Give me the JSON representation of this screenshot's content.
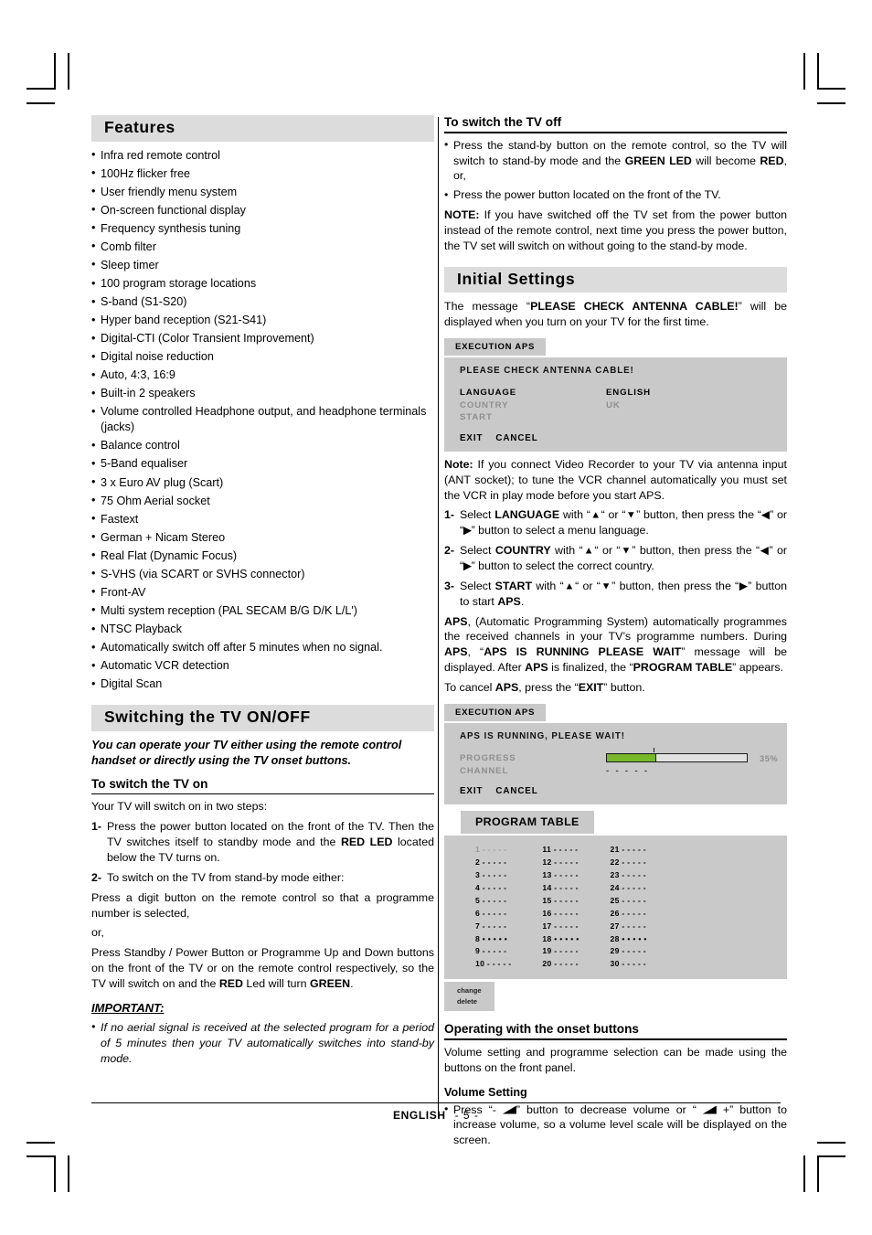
{
  "footer": {
    "language": "ENGLISH",
    "page": "- 5 -"
  },
  "left": {
    "features_header": "Features",
    "features": [
      "Infra red remote control",
      "100Hz flicker free",
      "User friendly menu system",
      "On-screen functional display",
      "Frequency synthesis tuning",
      "Comb filter",
      "Sleep timer",
      "100 program storage locations",
      "S-band (S1-S20)",
      "Hyper band reception (S21-S41)",
      "Digital-CTI (Color Transient Improvement)",
      "Digital noise reduction",
      "Auto, 4:3, 16:9",
      "Built-in 2 speakers",
      "Volume controlled Headphone output, and headphone terminals (jacks)",
      "Balance control",
      "5-Band equaliser",
      "3 x Euro AV plug (Scart)",
      "75 Ohm Aerial socket",
      "Fastext",
      "German + Nicam Stereo",
      "Real Flat (Dynamic Focus)",
      "S-VHS (via SCART or SVHS connector)",
      "Front-AV",
      "Multi system reception (PAL SECAM B/G D/K L/L')",
      "NTSC Playback",
      "Automatically switch off after 5 minutes when no signal.",
      "Automatic VCR detection",
      "Digital Scan"
    ],
    "switching_header": "Switching the TV ON/OFF",
    "switching_intro": "You can operate your TV either using the remote control handset or directly using the TV onset buttons.",
    "tv_on_header": "To switch the TV on",
    "tv_on_intro": "Your TV will switch on in two steps:",
    "step1_num": "1-",
    "step1_a": "Press the power button located on the front of the TV. Then the TV switches itself to standby mode and the ",
    "step1_bold": "RED LED",
    "step1_b": " located below the TV turns on.",
    "step2_num": "2-",
    "step2": "To switch on the TV from stand-by mode either:",
    "para_digit": "Press a digit button on the remote control so that a programme number is selected,",
    "or_text": "or,",
    "para_standby_a": "Press Standby / Power Button or Programme Up and Down buttons on the front of the TV or on the remote control respectively, so the TV will switch on and the ",
    "para_standby_red": "RED",
    "para_standby_b": " Led will turn ",
    "para_standby_green": "GREEN",
    "para_standby_c": ".",
    "important_header": "IMPORTANT:",
    "important_text": "If no aerial signal is received at the selected program for a period of 5 minutes then your TV automatically switches into stand-by mode."
  },
  "right": {
    "tv_off_header": "To switch the TV off",
    "tv_off_b1_a": "Press the stand-by button on the remote control, so the TV will switch to stand-by mode and the ",
    "tv_off_b1_green": "GREEN LED",
    "tv_off_b1_b": " will become ",
    "tv_off_b1_red": "RED",
    "tv_off_b1_c": ",    or,",
    "tv_off_b2": "Press the power button located on the front of the TV.",
    "note_label": "NOTE:",
    "note_text": " If you have switched off the TV set from the power button instead of the remote control, next time you press the power button, the TV set will switch on without going to the stand-by mode.",
    "initial_header": "Initial Settings",
    "initial_intro_a": "The message “",
    "initial_intro_bold": "PLEASE CHECK ANTENNA CABLE!",
    "initial_intro_b": "” will be displayed when you turn on your TV for the first time.",
    "osd1": {
      "tab": "EXECUTION APS",
      "message": "PLEASE  CHECK  ANTENNA  CABLE!",
      "rows": [
        {
          "label": "LANGUAGE",
          "value": "ENGLISH",
          "dim": false
        },
        {
          "label": "COUNTRY",
          "value": "UK",
          "dim": true
        },
        {
          "label": "START",
          "value": "",
          "dim": true
        }
      ],
      "exit": "EXIT",
      "cancel": "CANCEL"
    },
    "note2_label": "Note:",
    "note2_text": " If you connect Video Recorder to your TV via antenna input (ANT socket); to tune the VCR channel automatically you must set the VCR in play mode before you start APS.",
    "step1_num": "1-",
    "step1_a": "Select ",
    "step1_bold": "LANGUAGE",
    "step1_b": " with “",
    "step1_up": "▲",
    "step1_c": "“ or “",
    "step1_down": "▼",
    "step1_d": "” button, then press the “",
    "step1_left": "◀",
    "step1_e": "” or “",
    "step1_right": "▶",
    "step1_f": "” button to select a menu language.",
    "step2_num": "2-",
    "step2_bold": "COUNTRY",
    "step2_f": "” button to select the correct country.",
    "step3_num": "3-",
    "step3_bold": "START",
    "step3_d": "” button, then press the “",
    "step3_f": "” button to start ",
    "step3_aps": "APS",
    "step3_end": ".",
    "aps_para_a": "APS",
    "aps_para_b": ", (Automatic Programming System) automatically programmes the received channels in your TV’s programme numbers. During ",
    "aps_para_c": "APS",
    "aps_para_d": ", “",
    "aps_para_e": "APS IS RUNNING PLEASE WAIT",
    "aps_para_f": "” message will be displayed. After ",
    "aps_para_g": "APS",
    "aps_para_h": " is finalized, the “",
    "aps_para_i": "PROGRAM TABLE",
    "aps_para_j": "” appears.",
    "cancel_para_a": "To cancel ",
    "cancel_para_b": "APS",
    "cancel_para_c": ", press the “",
    "cancel_para_d": "EXIT",
    "cancel_para_e": "” button.",
    "osd2": {
      "tab": "EXECUTION APS",
      "message": "APS  IS  RUNNING,  PLEASE  WAIT!",
      "progress_label": "PROGRESS",
      "progress_percent": "35%",
      "progress_value": 35,
      "channel_label": "CHANNEL",
      "channel_value": "- - - - -",
      "exit": "EXIT",
      "cancel": "CANCEL"
    },
    "program_table": {
      "title": "PROGRAM TABLE",
      "columns": [
        [
          "1 - - - - -",
          "2 - - - - -",
          "3 - - - - -",
          "4 - - - - -",
          "5 - - - - -",
          "6 - - - - -",
          "7 - - - - -",
          "8 • • • • •",
          "9 - - - - -",
          "10 - - - - -"
        ],
        [
          "11 - - - - -",
          "12 - - - - -",
          "13 - - - - -",
          "14 - - - - -",
          "15 - - - - -",
          "16 - - - - -",
          "17 - - - - -",
          "18 • • • • •",
          "19 - - - - -",
          "20 - - - - -"
        ],
        [
          "21 - - - - -",
          "22 - - - - -",
          "23 - - - - -",
          "24 - - - - -",
          "25 - - - - -",
          "26 - - - - -",
          "27 - - - - -",
          "28 • • • • •",
          "29 - - - - -",
          "30 - - - - -"
        ]
      ],
      "foot_change": "change",
      "foot_delete": "delete"
    },
    "onset_header": "Operating with the onset buttons",
    "onset_intro": "Volume setting and programme selection can be made using the buttons on the front panel.",
    "volume_header": "Volume Setting",
    "vol_a": "Press “- ",
    "vol_b": "” button to decrease volume or “ ",
    "vol_c": " +” button to increase volume, so a volume level scale will be displayed on the screen."
  }
}
